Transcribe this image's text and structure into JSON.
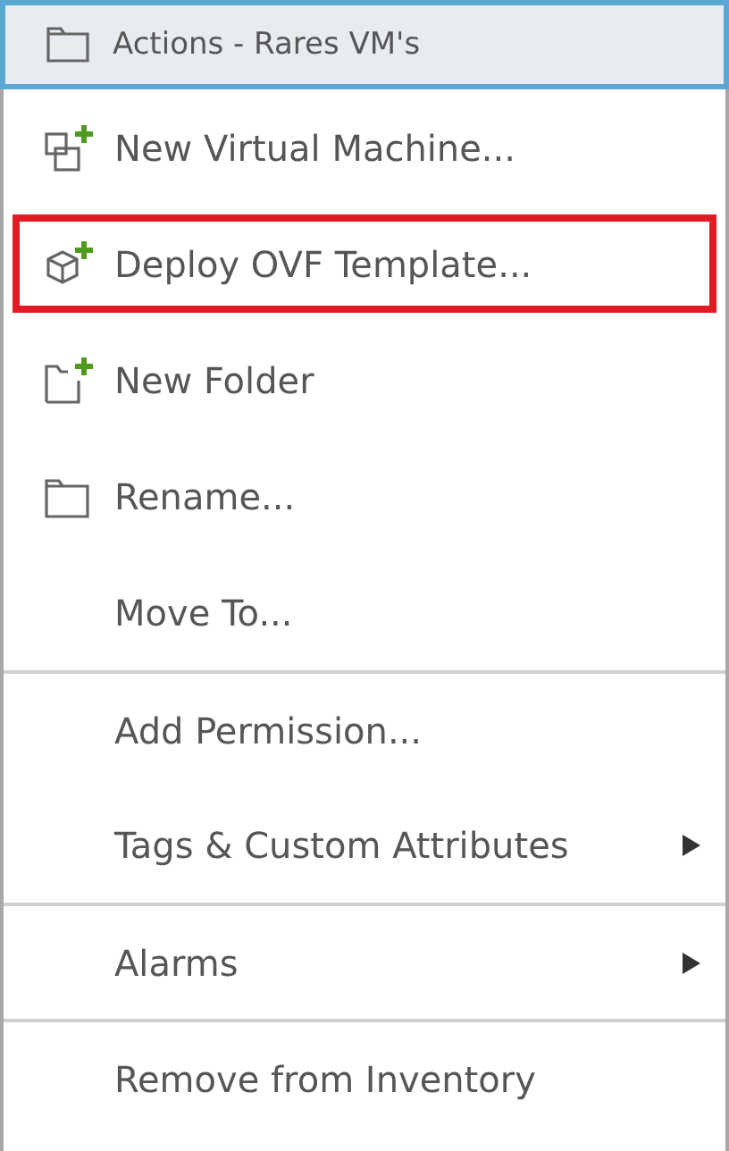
{
  "header": {
    "title": "Actions - Rares VM's"
  },
  "items": [
    {
      "label": "New Virtual Machine...",
      "kind": "vm-add",
      "highlighted": false,
      "submenu": false,
      "divider_before": false
    },
    {
      "label": "Deploy OVF Template...",
      "kind": "box-add",
      "highlighted": true,
      "submenu": false,
      "divider_before": false
    },
    {
      "label": "New Folder",
      "kind": "folder-add",
      "highlighted": false,
      "submenu": false,
      "divider_before": false
    },
    {
      "label": "Rename...",
      "kind": "folder",
      "highlighted": false,
      "submenu": false,
      "divider_before": false
    },
    {
      "label": "Move To...",
      "kind": "plain",
      "highlighted": false,
      "submenu": false,
      "divider_before": false
    },
    {
      "label": "Add Permission...",
      "kind": "plain",
      "highlighted": false,
      "submenu": false,
      "divider_before": true
    },
    {
      "label": "Tags & Custom Attributes",
      "kind": "plain",
      "highlighted": false,
      "submenu": true,
      "divider_before": false
    },
    {
      "label": "Alarms",
      "kind": "plain",
      "highlighted": false,
      "submenu": true,
      "divider_before": true
    },
    {
      "label": "Remove from Inventory",
      "kind": "plain",
      "highlighted": false,
      "submenu": false,
      "divider_before": true
    }
  ]
}
